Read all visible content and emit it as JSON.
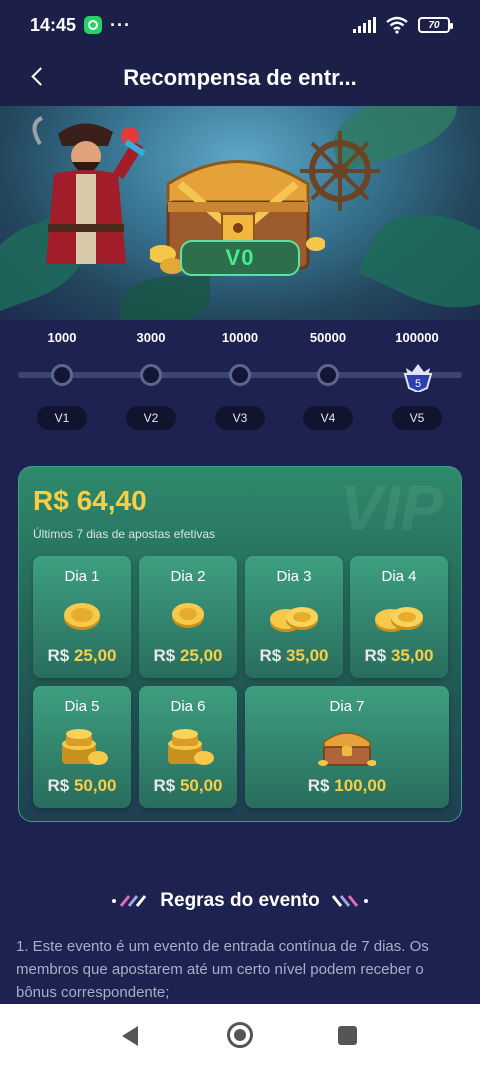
{
  "status_bar": {
    "time": "14:45",
    "dots": "···",
    "battery": "70"
  },
  "header": {
    "title": "Recompensa de entr..."
  },
  "banner": {
    "level": "V0"
  },
  "progress": {
    "thresholds": [
      "1000",
      "3000",
      "10000",
      "50000",
      "100000"
    ],
    "levels": [
      "V1",
      "V2",
      "V3",
      "V4",
      "V5"
    ],
    "current_badge": "5"
  },
  "card": {
    "amount": "R$ 64,40",
    "subtitle": "Últimos 7 dias de apostas efetivas",
    "watermark": "VIP",
    "days": [
      {
        "label": "Dia 1",
        "currency": "R$",
        "value": "25,00",
        "icon": "coin-icon"
      },
      {
        "label": "Dia 2",
        "currency": "R$",
        "value": "25,00",
        "icon": "coin-icon"
      },
      {
        "label": "Dia 3",
        "currency": "R$",
        "value": "35,00",
        "icon": "coins-icon"
      },
      {
        "label": "Dia 4",
        "currency": "R$",
        "value": "35,00",
        "icon": "coins-icon"
      },
      {
        "label": "Dia 5",
        "currency": "R$",
        "value": "50,00",
        "icon": "coin-stack-icon"
      },
      {
        "label": "Dia 6",
        "currency": "R$",
        "value": "50,00",
        "icon": "coin-stack-icon"
      },
      {
        "label": "Dia 7",
        "currency": "R$",
        "value": "100,00",
        "icon": "treasure-chest-icon"
      }
    ]
  },
  "rules": {
    "title": "Regras do evento",
    "text": "1. Este evento é um evento de entrada contínua de 7 dias. Os membros que apostarem até um certo nível podem receber o bônus correspondente;"
  },
  "colors": {
    "accent_gold": "#f7cf45",
    "level_green": "#3ff08e",
    "background": "#1e2250",
    "card_green": "#2f8a6c"
  }
}
